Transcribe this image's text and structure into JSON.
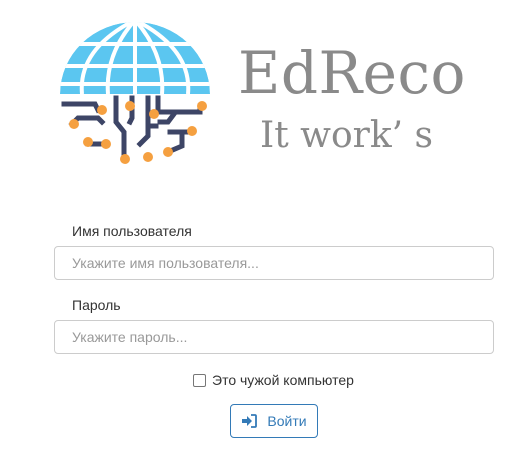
{
  "brand": {
    "name": "EdReco",
    "tagline": "It work’ s"
  },
  "form": {
    "username": {
      "label": "Имя пользователя",
      "placeholder": "Укажите имя пользователя...",
      "value": ""
    },
    "password": {
      "label": "Пароль",
      "placeholder": "Укажите пароль...",
      "value": ""
    },
    "remember": {
      "label": "Это чужой компьютер",
      "checked": false
    },
    "submit": {
      "label": "Войти",
      "icon": "sign-in-icon"
    }
  },
  "colors": {
    "globe": "#5bc6f0",
    "circuit_lines": "#3d4566",
    "circuit_nodes": "#f5a040",
    "brand_text": "#8a8a8a",
    "button_accent": "#337ab7"
  }
}
